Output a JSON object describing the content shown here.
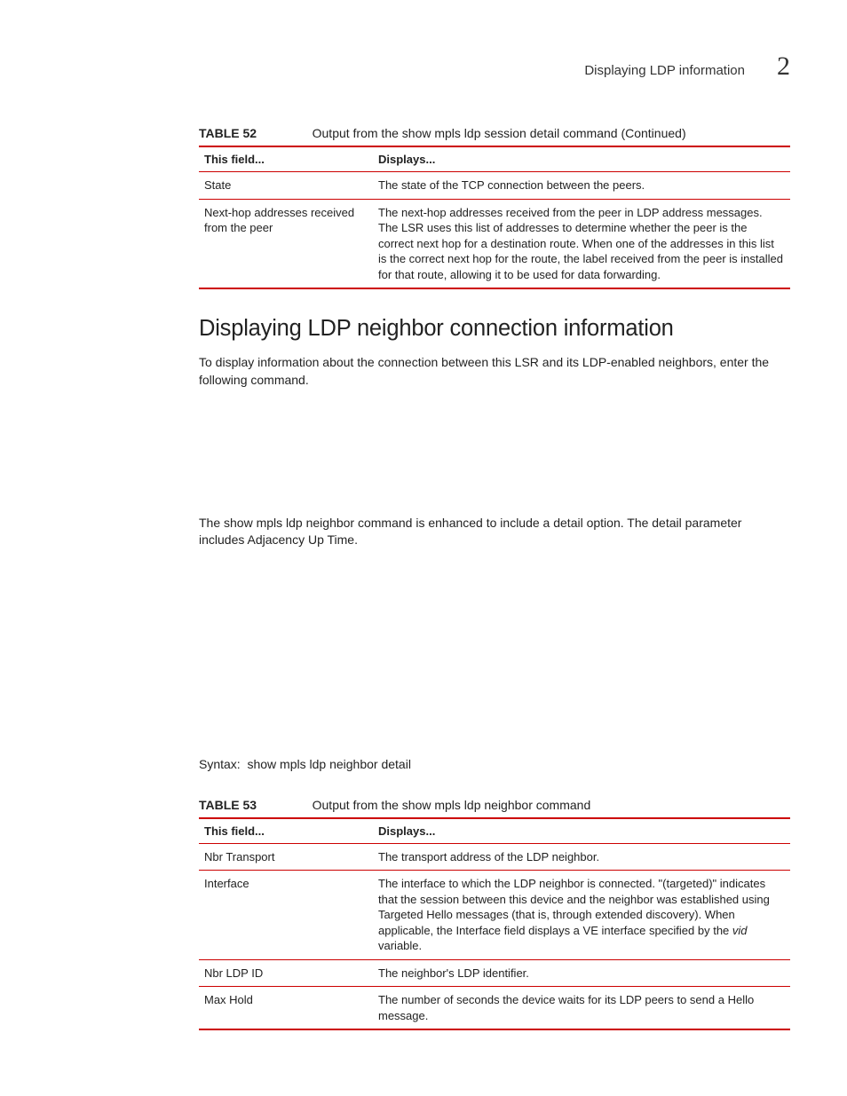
{
  "header": {
    "title": "Displaying LDP information",
    "chapter": "2"
  },
  "table52": {
    "number": "TABLE 52",
    "title": "Output from the show mpls ldp session detail command  (Continued)",
    "head": {
      "c1": "This field...",
      "c2": "Displays..."
    },
    "rows": [
      {
        "c1": "State",
        "c2": "The state of the TCP connection between the peers."
      },
      {
        "c1": "Next-hop addresses received from the peer",
        "c2": "The next-hop addresses received from the peer in LDP address messages. The LSR uses this list of addresses to determine whether the peer is the correct next hop for a destination route. When one of the addresses in this list is the correct next hop for the route, the label received from the peer is installed for that route, allowing it to be used for data forwarding."
      }
    ]
  },
  "section": {
    "heading": "Displaying LDP neighbor connection information",
    "para1": "To display information about the connection between this LSR and its LDP-enabled neighbors, enter the following command.",
    "para2": "The show mpls ldp neighbor command is enhanced to include a detail option. The detail parameter includes Adjacency Up Time.",
    "syntax_label": "Syntax:",
    "syntax_cmd": "show mpls ldp neighbor detail"
  },
  "table53": {
    "number": "TABLE 53",
    "title": "Output from the show mpls ldp neighbor command",
    "head": {
      "c1": "This field...",
      "c2": "Displays..."
    },
    "rows": [
      {
        "c1": "Nbr Transport",
        "c2": "The transport address of the LDP neighbor."
      },
      {
        "c1": "Interface",
        "c2_pre": "The interface to which the LDP neighbor is connected. \"(targeted)\" indicates that the session between this device and the neighbor was established using Targeted Hello messages (that is, through extended discovery). When applicable, the Interface field displays a VE interface specified by the ",
        "c2_var": "vid",
        "c2_post": " variable."
      },
      {
        "c1": "Nbr LDP ID",
        "c2": "The neighbor's LDP identifier."
      },
      {
        "c1": "Max Hold",
        "c2": "The number of seconds the device waits for its LDP peers to send a Hello message."
      }
    ]
  }
}
